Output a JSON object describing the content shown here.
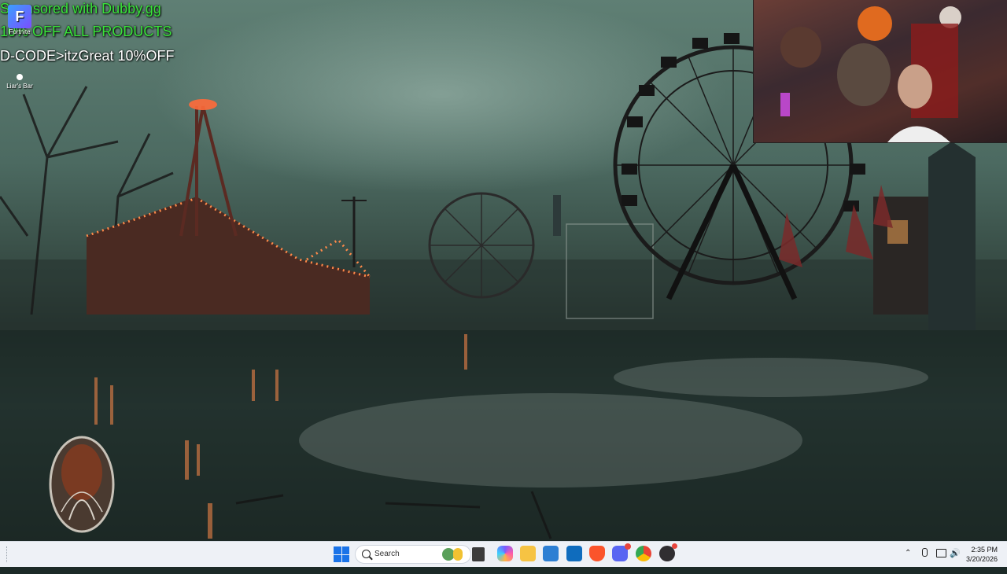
{
  "overlay": {
    "line1": "Sponsored with Dubby.gg",
    "line2": "10% OFF ALL PRODUCTS",
    "line3": "D-CODE>itzGreat 10%OFF"
  },
  "desktop_icons": [
    {
      "label": "Fortnite",
      "icon": "fortnite-icon"
    },
    {
      "label": "Liar's Bar",
      "icon": "liars-bar-icon"
    }
  ],
  "taskbar": {
    "search_label": "Search",
    "apps": [
      {
        "name": "widgets-icon",
        "color": "#f4b43a"
      },
      {
        "name": "task-view-icon",
        "color": "#444444"
      },
      {
        "name": "copilot-icon",
        "color": "#7a5cff"
      },
      {
        "name": "file-explorer-icon",
        "color": "#f6c343"
      },
      {
        "name": "microsoft-store-icon",
        "color": "#2d7fd3"
      },
      {
        "name": "outlook-icon",
        "color": "#0f6cbd"
      },
      {
        "name": "brave-icon",
        "color": "#fb542b"
      },
      {
        "name": "discord-icon",
        "color": "#5865f2"
      },
      {
        "name": "chrome-icon",
        "color": "#34a853"
      },
      {
        "name": "obs-icon",
        "color": "#302e31"
      }
    ],
    "discord_badge": "",
    "clock": {
      "time": "2:35 PM",
      "date": "3/20/2026"
    }
  },
  "colors": {
    "overlay_green": "#39e23a",
    "taskbar_bg": "#eef1f6",
    "accent_blue": "#1a73e8"
  }
}
